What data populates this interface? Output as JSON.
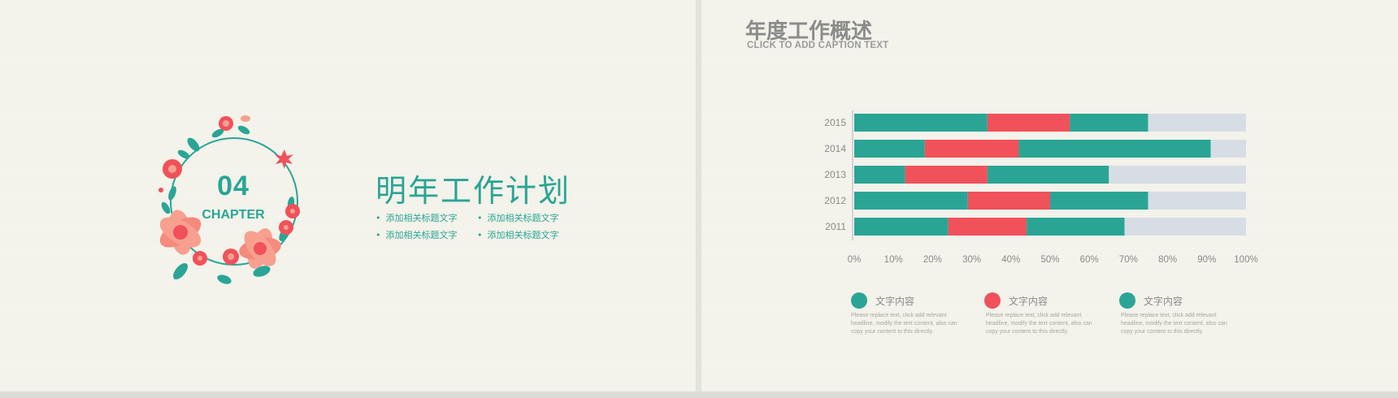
{
  "left_slide": {
    "chapter_number": "04",
    "chapter_word": "CHAPTER",
    "title": "明年工作计划",
    "bullets": [
      "添加相关标题文字",
      "添加相关标题文字",
      "添加相关标题文字",
      "添加相关标题文字"
    ],
    "colors": {
      "teal": "#2aa595",
      "red": "#f0515a",
      "pink": "#f7a08f"
    }
  },
  "right_slide": {
    "title": "年度工作概述",
    "caption": "CLICK TO ADD CAPTION TEXT",
    "legend": [
      {
        "label": "文字内容",
        "color": "#2aa595",
        "desc": "Please replace text, click add relevant headline, modify the text content, also can copy your content to this directly."
      },
      {
        "label": "文字内容",
        "color": "#f0515a",
        "desc": "Please replace text, click add relevant headline, modify the text content, also can copy your content to this directly."
      },
      {
        "label": "文字内容",
        "color": "#2aa595",
        "desc": "Please replace text, click add relevant headline, modify the text content, also can copy your content to this directly."
      }
    ]
  },
  "chart_data": {
    "type": "bar",
    "orientation": "horizontal",
    "stacked": true,
    "categories": [
      "2015",
      "2014",
      "2013",
      "2012",
      "2011"
    ],
    "x_ticks": [
      "0%",
      "10%",
      "20%",
      "30%",
      "40%",
      "50%",
      "60%",
      "70%",
      "80%",
      "90%",
      "100%"
    ],
    "xlim": [
      0,
      100
    ],
    "series": [
      {
        "color": "#2aa595",
        "values": [
          34,
          18,
          13,
          29,
          24
        ]
      },
      {
        "color": "#f0515a",
        "values": [
          21,
          24,
          21,
          21,
          20
        ]
      },
      {
        "color": "#2aa595",
        "values": [
          20,
          49,
          31,
          25,
          25
        ]
      },
      {
        "color": "#d7dde5",
        "values": [
          25,
          9,
          35,
          25,
          31
        ]
      }
    ],
    "grid": false,
    "legend_position": "bottom"
  }
}
